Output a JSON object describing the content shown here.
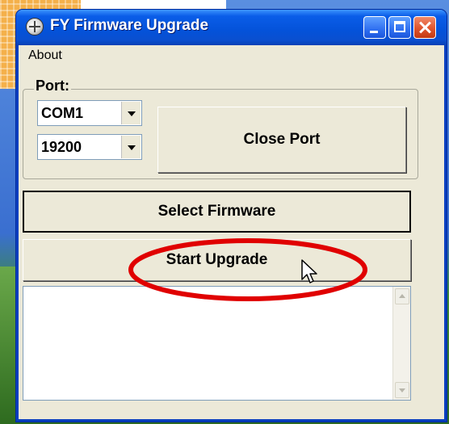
{
  "window": {
    "title": "FY Firmware Upgrade"
  },
  "menu": {
    "items": [
      {
        "label": "About"
      }
    ]
  },
  "port_group": {
    "label": "Port:",
    "port_select": {
      "value": "COM1"
    },
    "baud_select": {
      "value": "19200"
    },
    "close_port_label": "Close Port"
  },
  "actions": {
    "select_firmware_label": "Select Firmware",
    "start_upgrade_label": "Start Upgrade"
  },
  "log": {
    "content": ""
  },
  "annotation": {
    "highlight_color": "#e00000",
    "highlight_target": "start-upgrade-button"
  },
  "icons": [
    "app-icon",
    "minimize-icon",
    "maximize-icon",
    "close-icon",
    "chevron-down-icon",
    "scroll-up-icon",
    "scroll-down-icon",
    "mouse-cursor-icon"
  ]
}
